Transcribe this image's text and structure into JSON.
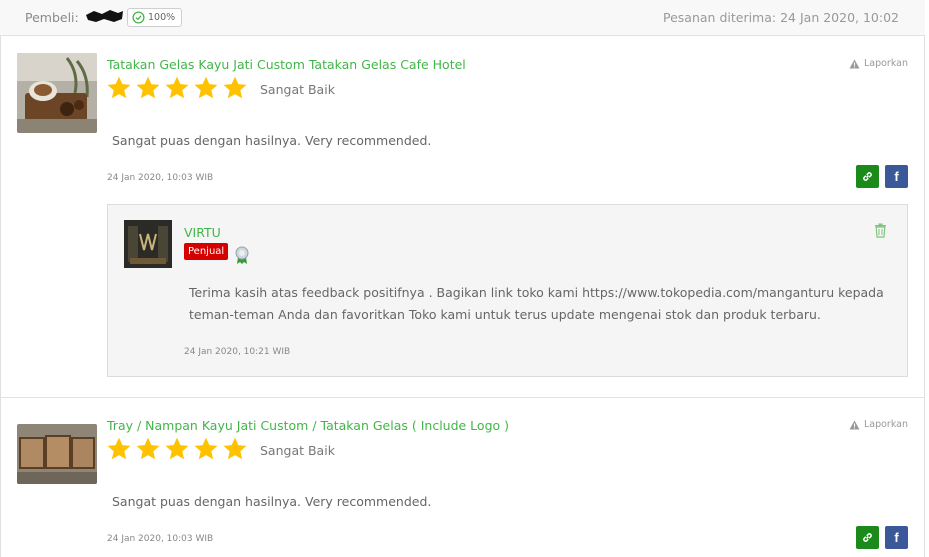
{
  "header": {
    "buyer_label": "Pembeli:",
    "reputation_percent": "100%",
    "received_label": "Pesanan diterima:",
    "received_date": "24 Jan 2020, 10:02"
  },
  "reviews": [
    {
      "product_title": "Tatakan Gelas Kayu Jati Custom Tatakan Gelas Cafe Hotel",
      "stars": 5,
      "rating_label": "Sangat Baik",
      "report_label": "Laporkan",
      "text": "Sangat puas dengan hasilnya. Very recommended.",
      "date": "24 Jan 2020, 10:03 WIB",
      "reply": {
        "name": "VIRTU",
        "role": "Penjual",
        "body": "Terima kasih atas feedback positifnya . Bagikan link toko kami https://www.tokopedia.com/manganturu kepada teman-teman Anda dan favoritkan Toko kami untuk terus update mengenai stok dan produk terbaru.",
        "date": "24 Jan 2020, 10:21 WIB"
      }
    },
    {
      "product_title": "Tray / Nampan Kayu Jati Custom / Tatakan Gelas ( Include Logo )",
      "stars": 5,
      "rating_label": "Sangat Baik",
      "report_label": "Laporkan",
      "text": "Sangat puas dengan hasilnya. Very recommended.",
      "date": "24 Jan 2020, 10:03 WIB"
    }
  ],
  "colors": {
    "accent_green": "#42b549",
    "star": "#ffc200",
    "seller_badge": "#d50000",
    "link_button": "#1b8a1b",
    "facebook": "#3b5998"
  },
  "icons": [
    "check-circle-icon",
    "star-icon",
    "warning-icon",
    "link-icon",
    "facebook-icon",
    "trash-icon",
    "medal-icon"
  ]
}
